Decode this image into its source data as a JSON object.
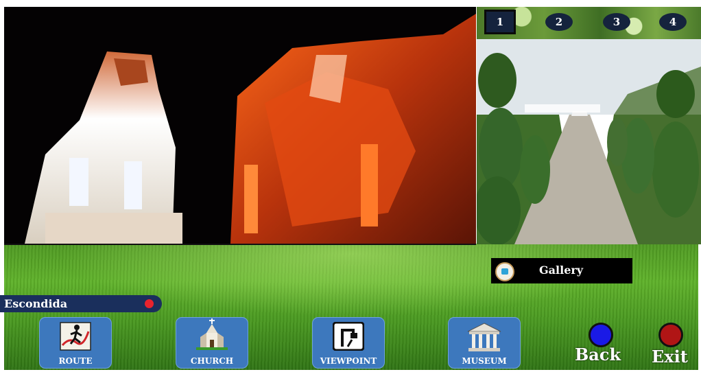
{
  "thumbnails": [
    {
      "label": "1",
      "selected": true
    },
    {
      "label": "2",
      "selected": false
    },
    {
      "label": "3",
      "selected": false
    },
    {
      "label": "4",
      "selected": false
    }
  ],
  "gallery": {
    "label": "Gallery"
  },
  "location": {
    "label": "Escondida",
    "indicator_color": "#e8232d"
  },
  "nav": {
    "route": "ROUTE",
    "church": "CHURCH",
    "viewpoint": "VIEWPOINT",
    "museum": "MUSEUM"
  },
  "controls": {
    "back": "Back",
    "exit": "Exit",
    "back_color": "#1a1ae6",
    "exit_color": "#b01515"
  }
}
